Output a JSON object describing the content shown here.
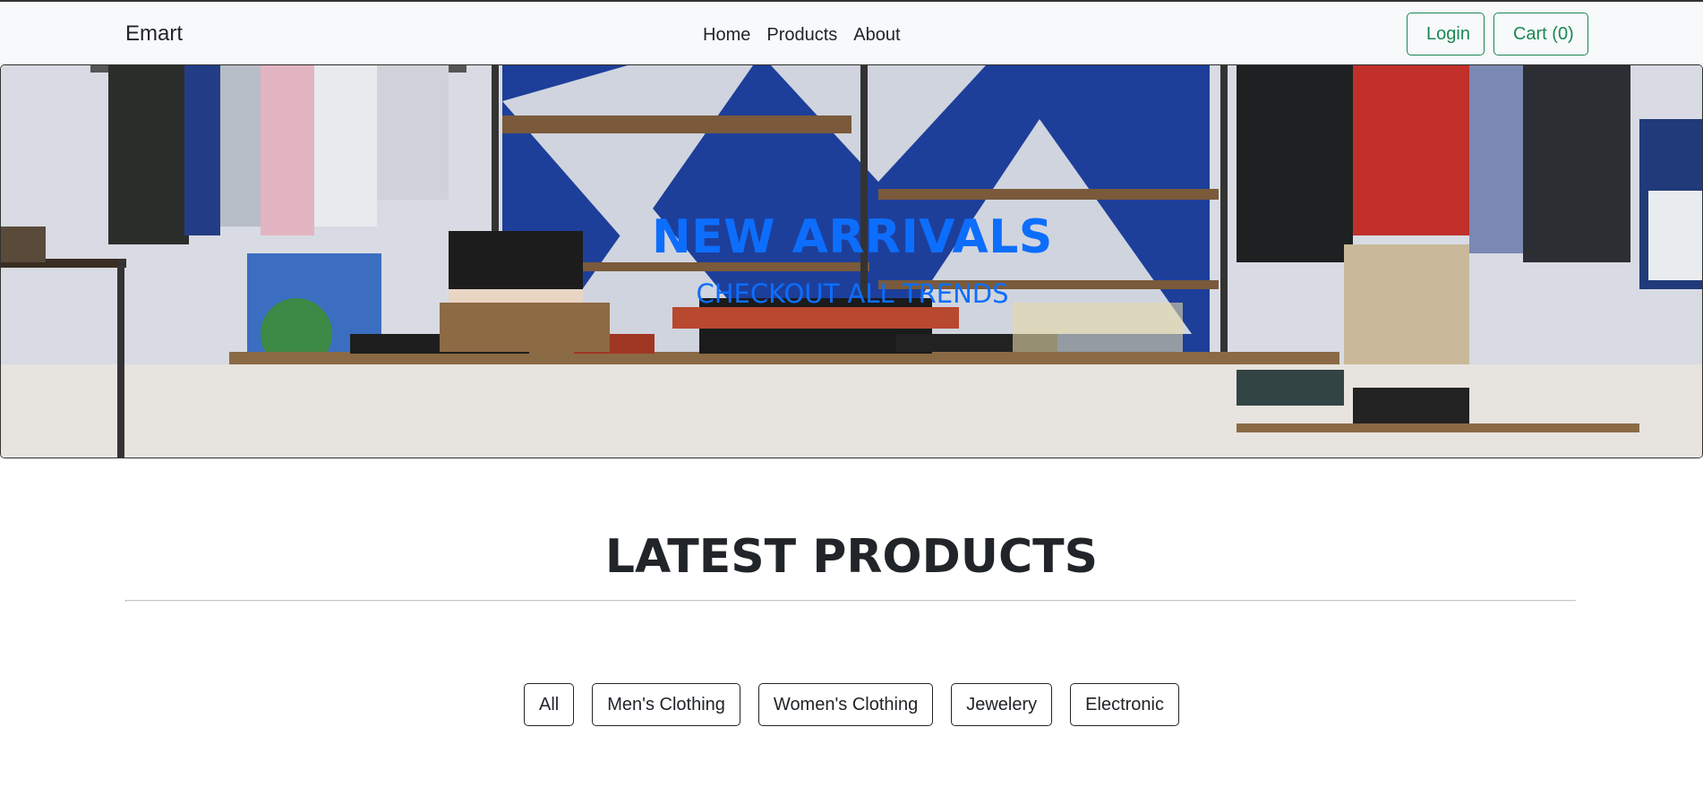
{
  "navbar": {
    "brand": "Emart",
    "links": [
      "Home",
      "Products",
      "About"
    ],
    "login_label": "Login",
    "cart_label": "Cart (0)"
  },
  "hero": {
    "title": "NEW ARRIVALS",
    "subtitle": "CHECKOUT ALL TRENDS"
  },
  "products": {
    "heading": "LATEST PRODUCTS",
    "filters": [
      "All",
      "Men's Clothing",
      "Women's Clothing",
      "Jewelery",
      "Electronic"
    ]
  },
  "colors": {
    "accent_blue": "#0d6efd",
    "success_green": "#198754",
    "text_dark": "#212529"
  }
}
